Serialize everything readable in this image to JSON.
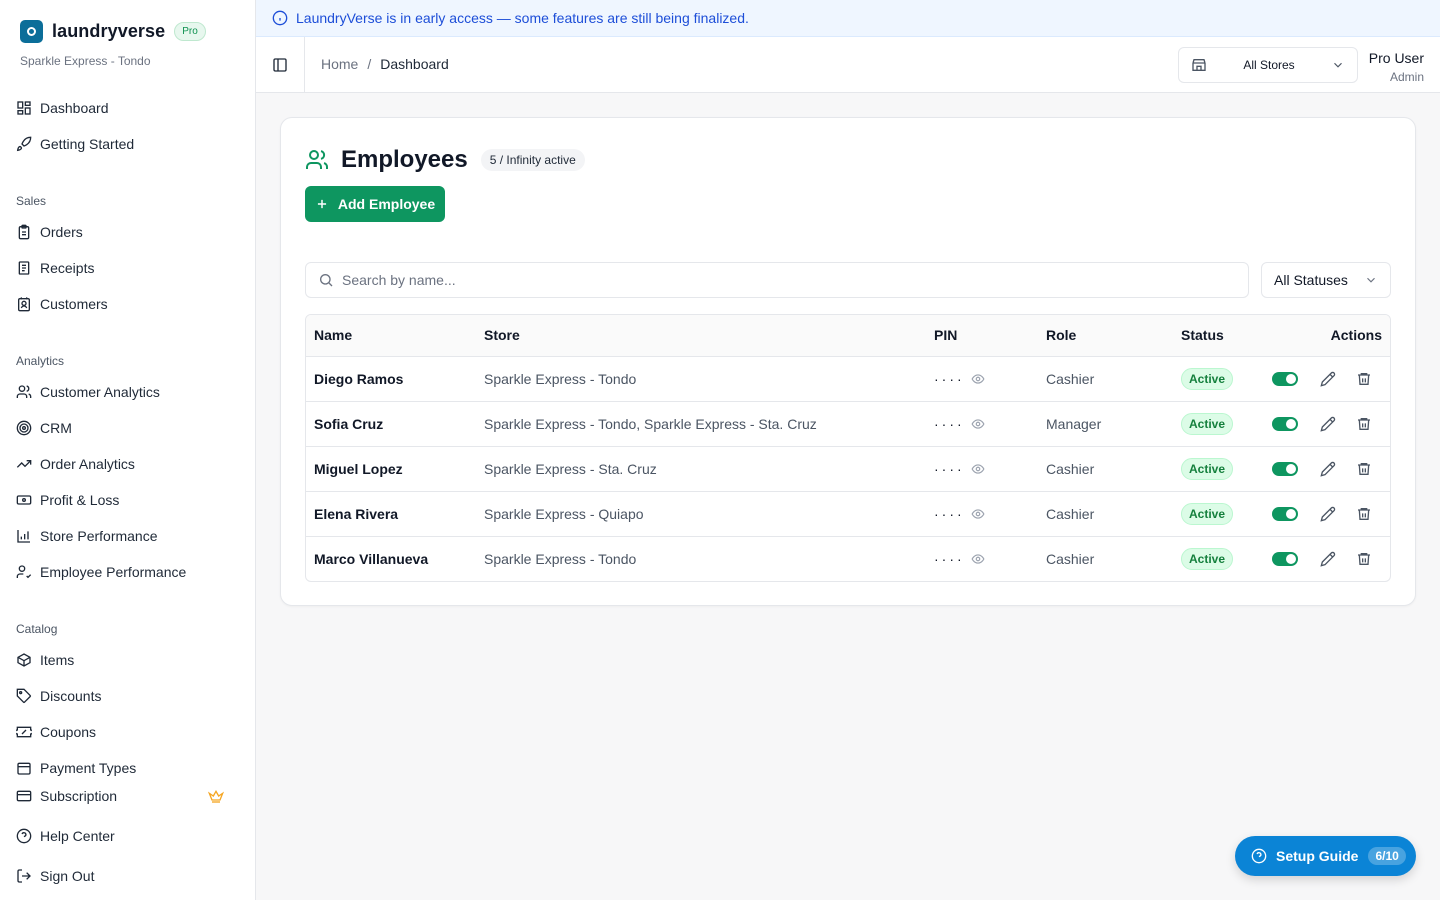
{
  "banner": {
    "text": "LaundryVerse is in early access — some features are still being finalized."
  },
  "brand": {
    "name": "laundryverse",
    "badge": "Pro",
    "store": "Sparkle Express - Tondo"
  },
  "sidebar": {
    "top": [
      {
        "label": "Dashboard",
        "icon": "grid-icon"
      },
      {
        "label": "Getting Started",
        "icon": "rocket-icon"
      }
    ],
    "sales_label": "Sales",
    "sales": [
      {
        "label": "Orders",
        "icon": "clipboard-icon"
      },
      {
        "label": "Receipts",
        "icon": "receipt-icon"
      },
      {
        "label": "Customers",
        "icon": "contact-icon"
      }
    ],
    "analytics_label": "Analytics",
    "analytics": [
      {
        "label": "Customer Analytics",
        "icon": "users-icon"
      },
      {
        "label": "CRM",
        "icon": "target-icon"
      },
      {
        "label": "Order Analytics",
        "icon": "trending-up-icon"
      },
      {
        "label": "Profit & Loss",
        "icon": "banknote-icon"
      },
      {
        "label": "Store Performance",
        "icon": "bar-chart-icon"
      },
      {
        "label": "Employee Performance",
        "icon": "user-check-icon"
      }
    ],
    "catalog_label": "Catalog",
    "catalog": [
      {
        "label": "Items",
        "icon": "package-icon"
      },
      {
        "label": "Discounts",
        "icon": "tag-icon"
      },
      {
        "label": "Coupons",
        "icon": "ticket-icon"
      },
      {
        "label": "Payment Types",
        "icon": "wallet-icon"
      }
    ],
    "bottom": [
      {
        "label": "Subscription",
        "icon": "credit-card-icon"
      },
      {
        "label": "Help Center",
        "icon": "help-circle-icon"
      },
      {
        "label": "Sign Out",
        "icon": "log-out-icon"
      }
    ],
    "accent_crown": "#f5a623"
  },
  "header": {
    "breadcrumb": [
      "Home",
      "Dashboard"
    ],
    "store_select": "All Stores",
    "user_name": "Pro User",
    "user_role": "Admin"
  },
  "page": {
    "title": "Employees",
    "count_badge": "5 / Infinity active",
    "add_button": "Add Employee",
    "search_placeholder": "Search by name...",
    "status_filter": "All Statuses"
  },
  "table": {
    "headers": [
      "Name",
      "Store",
      "PIN",
      "Role",
      "Status",
      "Actions"
    ],
    "rows": [
      {
        "name": "Diego Ramos",
        "store": "Sparkle Express - Tondo",
        "pin": "····",
        "role": "Cashier",
        "status": "Active"
      },
      {
        "name": "Sofia Cruz",
        "store": "Sparkle Express - Tondo, Sparkle Express - Sta. Cruz",
        "pin": "····",
        "role": "Manager",
        "status": "Active"
      },
      {
        "name": "Miguel Lopez",
        "store": "Sparkle Express - Sta. Cruz",
        "pin": "····",
        "role": "Cashier",
        "status": "Active"
      },
      {
        "name": "Elena Rivera",
        "store": "Sparkle Express - Quiapo",
        "pin": "····",
        "role": "Cashier",
        "status": "Active"
      },
      {
        "name": "Marco Villanueva",
        "store": "Sparkle Express - Tondo",
        "pin": "····",
        "role": "Cashier",
        "status": "Active"
      }
    ]
  },
  "setup_guide": {
    "label": "Setup Guide",
    "progress": "6/10"
  },
  "colors": {
    "primary": "#0e9660",
    "accent_blue": "#0b84d6",
    "banner_text": "#1d4ed8"
  }
}
